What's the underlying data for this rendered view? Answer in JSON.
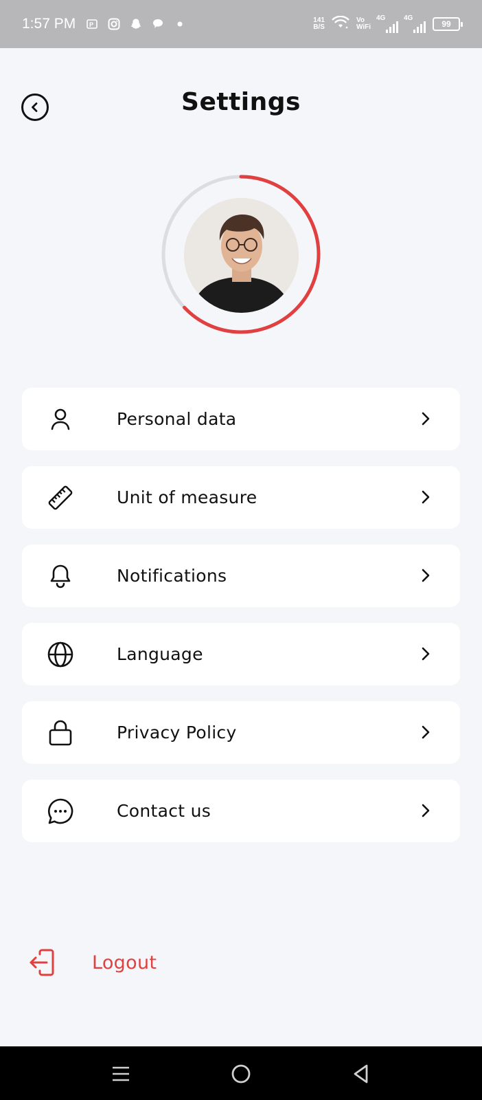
{
  "status_bar": {
    "time": "1:57 PM",
    "net_speed_value": "141",
    "net_speed_unit": "B/S",
    "vo_label": "Vo",
    "wifi_label": "WiFi",
    "network_label_1": "4G",
    "network_label_2": "4G",
    "battery": "99",
    "left_icons": [
      "paytm-icon",
      "instagram-icon",
      "snapchat-icon",
      "chat-bubble-icon",
      "dot-icon"
    ]
  },
  "header": {
    "title": "Settings",
    "back_icon": "chevron-left-circle-icon"
  },
  "profile": {
    "progress_fraction": 0.63,
    "progress_color": "#e0403f",
    "track_color": "#dcdde3"
  },
  "menu": {
    "items": [
      {
        "label": "Personal data",
        "icon": "user-icon"
      },
      {
        "label": "Unit of measure",
        "icon": "ruler-icon"
      },
      {
        "label": "Notifications",
        "icon": "bell-icon"
      },
      {
        "label": "Language",
        "icon": "globe-icon"
      },
      {
        "label": "Privacy Policy",
        "icon": "lock-icon"
      },
      {
        "label": "Contact us",
        "icon": "chat-icon"
      }
    ]
  },
  "logout": {
    "label": "Logout",
    "color": "#e0403f",
    "icon": "logout-icon"
  },
  "nav_bar": {
    "buttons": [
      "recent-apps-icon",
      "home-icon",
      "back-triangle-icon"
    ]
  }
}
